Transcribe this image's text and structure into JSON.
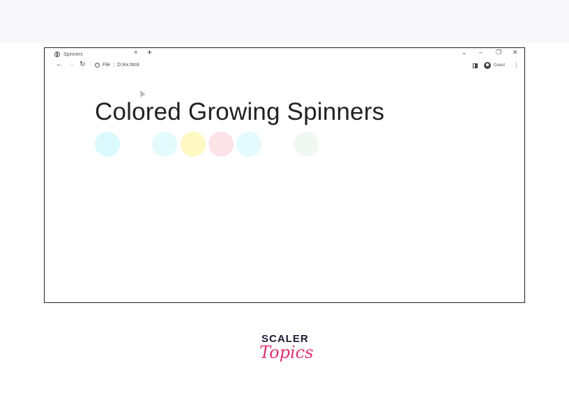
{
  "browser": {
    "tab": {
      "title": "Spinners",
      "close_glyph": "×",
      "new_tab_glyph": "+"
    },
    "window_controls": {
      "tab_search_glyph": "⌄",
      "minimize_glyph": "–",
      "restore_glyph": "❐",
      "close_glyph": "✕"
    },
    "toolbar": {
      "back_glyph": "←",
      "forward_glyph": "→",
      "reload_glyph": "↻",
      "info_glyph": "i",
      "scheme_label": "File",
      "separator": "|",
      "url": "D:/ex.html",
      "profile_label": "Guest",
      "menu_glyph": "⋮"
    }
  },
  "page": {
    "title": "Colored Growing Spinners",
    "spinners": [
      {
        "color": "#a6f3fb",
        "opacity": 0.4
      },
      {
        "color": "#a6f3fb",
        "opacity": 0.3
      },
      {
        "color": "#fdf27a",
        "opacity": 0.45
      },
      {
        "color": "#f6b9c6",
        "opacity": 0.4
      },
      {
        "color": "#a6f3fb",
        "opacity": 0.3
      },
      {
        "color": "#cfe5d6",
        "opacity": 0.3
      }
    ]
  },
  "branding": {
    "line1": "SCALER",
    "line2": "Topics",
    "colors": {
      "dark": "#1b1b34",
      "accent": "#e0306f"
    }
  }
}
